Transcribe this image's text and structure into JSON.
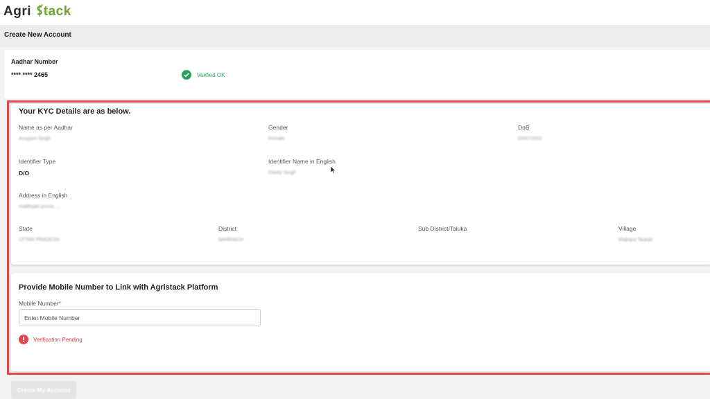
{
  "logo": {
    "part1": "Agri",
    "part2": "tack"
  },
  "subheader": {
    "title": "Create New Account"
  },
  "aadhar": {
    "label": "Aadhar Number",
    "value": "**** **** 2465",
    "status": "Verified OK"
  },
  "kyc": {
    "heading": "Your KYC Details are as below.",
    "name_label": "Name as per Aadhar",
    "name_value": "Anupam Singh",
    "gender_label": "Gender",
    "gender_value": "Female",
    "dob_label": "DoB",
    "dob_value": "05/07/2002",
    "identifier_type_label": "Identifier Type",
    "identifier_type_value": "D/O",
    "identifier_name_label": "Identifier Name in English",
    "identifier_name_value": "Dileep Singh",
    "address_label": "Address in English",
    "address_value": "madhiyan purva, ...",
    "state_label": "State",
    "state_value": "UTTAR PRADESH",
    "district_label": "District",
    "district_value": "BAHRAICH",
    "subdistrict_label": "Sub District/Taluka",
    "village_label": "Village",
    "village_value": "Majhara Taukali"
  },
  "mobile": {
    "heading": "Provide Mobile Number to Link with Agristack Platform",
    "label": "Mobile Number",
    "required_mark": "*",
    "placeholder": "Enter Mobile Number",
    "status": "Verification Pending"
  },
  "actions": {
    "create_label": "Create My Account"
  },
  "colors": {
    "brand_green": "#6aa52a",
    "verified_green": "#2e9e5b",
    "alert_red": "#e5454b"
  },
  "icons": {
    "verified": "check-circle-icon",
    "pending": "exclamation-circle-icon"
  }
}
